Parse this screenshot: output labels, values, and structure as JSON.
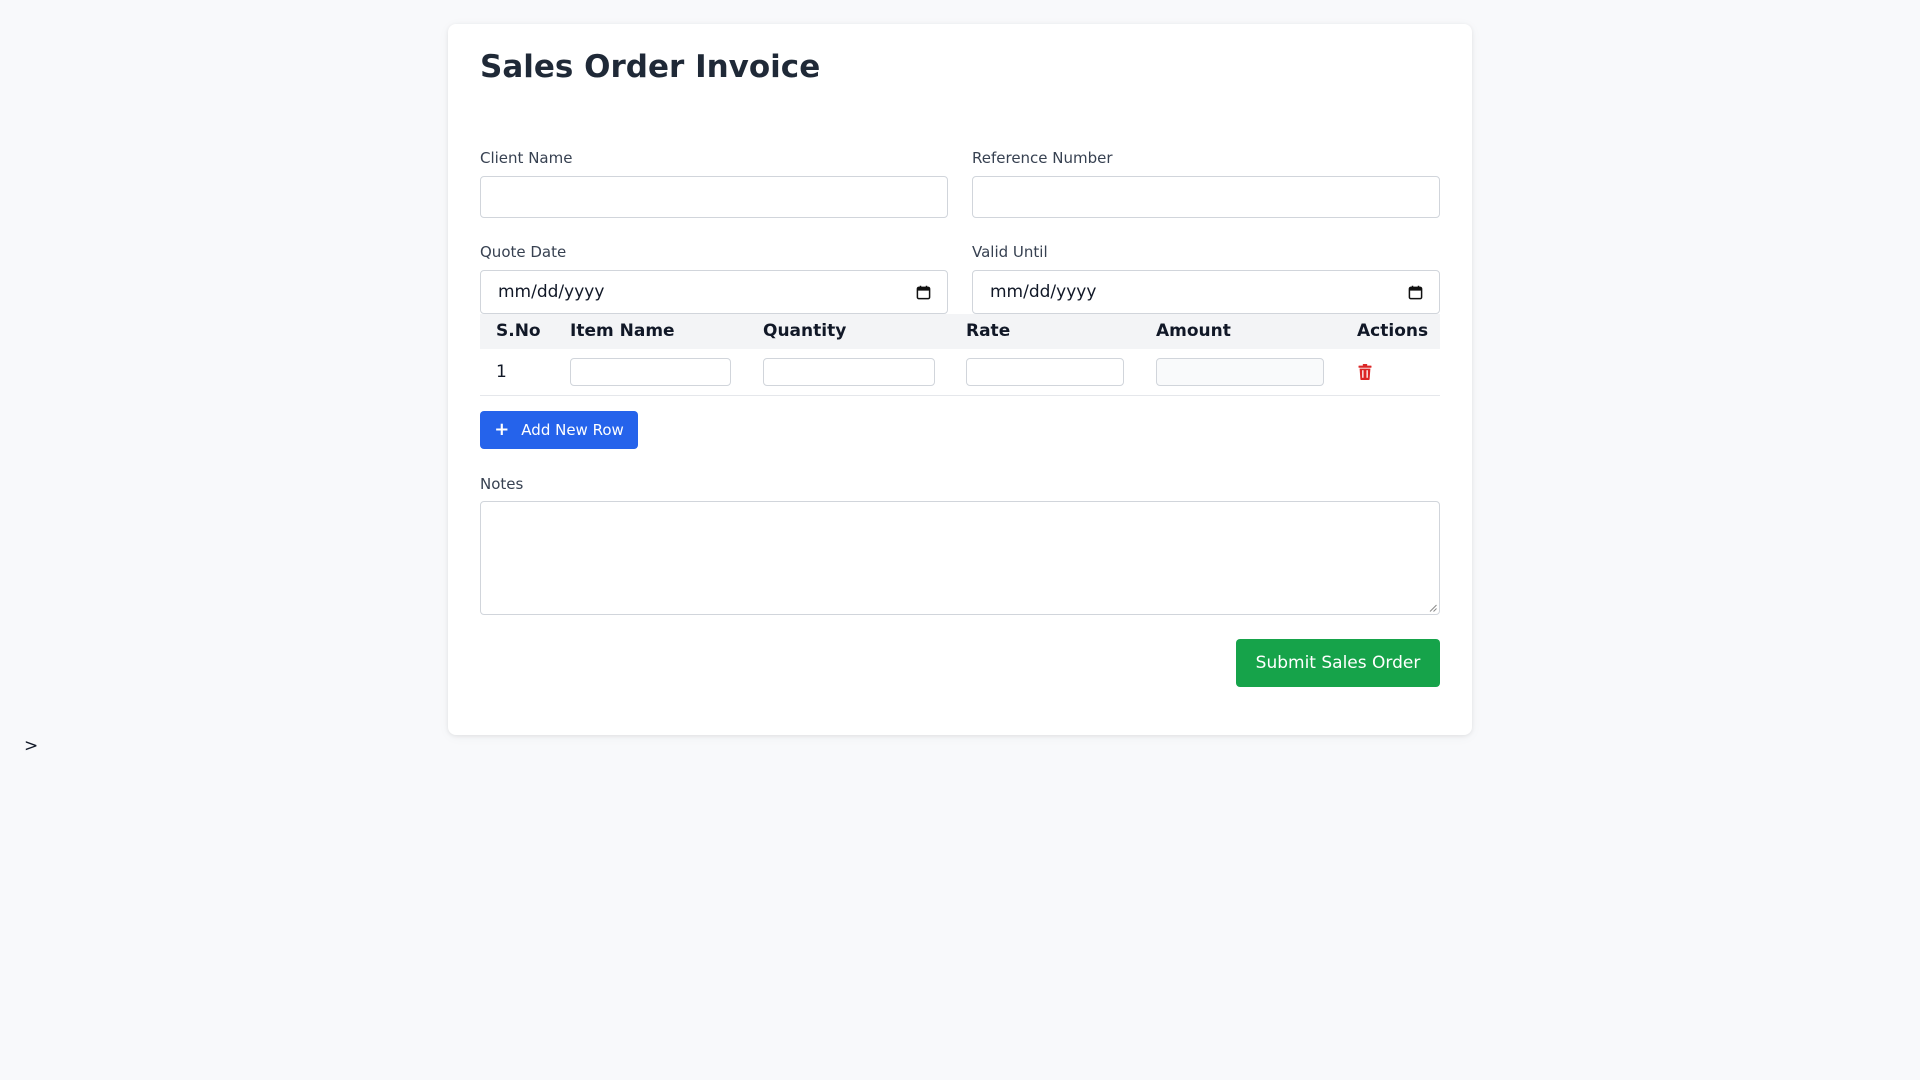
{
  "form": {
    "title": "Sales Order Invoice",
    "client_name": {
      "label": "Client Name",
      "value": ""
    },
    "reference_number": {
      "label": "Reference Number",
      "value": ""
    },
    "quote_date": {
      "label": "Quote Date",
      "value": "mm/dd/yyyy"
    },
    "valid_until": {
      "label": "Valid Until",
      "value": "mm/dd/yyyy"
    }
  },
  "items_table": {
    "headers": [
      "S.No",
      "Item Name",
      "Quantity",
      "Rate",
      "Amount",
      "Actions"
    ],
    "rows": [
      {
        "sno": "1",
        "item_name": "",
        "quantity": "",
        "rate": "",
        "amount": ""
      }
    ]
  },
  "add_row_label": "Add New Row",
  "notes": {
    "label": "Notes",
    "value": ""
  },
  "submit_label": "Submit Sales Order",
  "stray_text": ">",
  "icons": {
    "add": "plus-icon",
    "delete": "trash-icon",
    "date": "calendar-icon"
  },
  "colors": {
    "primary": "#2563eb",
    "success": "#16a34a",
    "danger": "#dc2626"
  }
}
